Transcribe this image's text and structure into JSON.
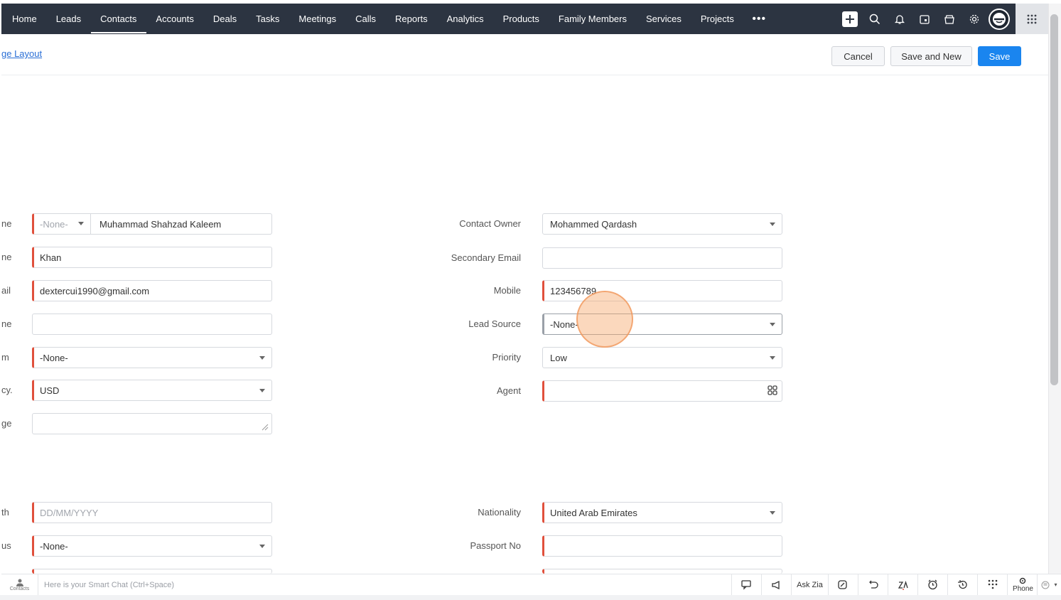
{
  "nav": {
    "items": [
      "Home",
      "Leads",
      "Contacts",
      "Accounts",
      "Deals",
      "Tasks",
      "Meetings",
      "Calls",
      "Reports",
      "Analytics",
      "Products",
      "Family Members",
      "Services",
      "Projects"
    ],
    "active": "Contacts",
    "more": "•••"
  },
  "header": {
    "layout_link": "ge Layout",
    "cancel": "Cancel",
    "save_and_new": "Save and New",
    "save": "Save",
    "primary_color": "#1a85ef"
  },
  "left_form": {
    "labels": [
      "ne",
      "ne",
      "ail",
      "ne",
      "m",
      "cy.",
      "ge",
      "th",
      "us"
    ],
    "salutation": "-None-",
    "first_name": "Muhammad Shahzad Kaleem",
    "last_name": "Khan",
    "email": "dextercui1990@gmail.com",
    "phone": "",
    "platform": "-None-",
    "currency": "USD",
    "message": "",
    "date_placeholder": "DD/MM/YYYY",
    "status": "-None-"
  },
  "right_form": {
    "contact_owner_label": "Contact Owner",
    "contact_owner": "Mohammed Qardash",
    "secondary_email_label": "Secondary Email",
    "secondary_email": "",
    "mobile_label": "Mobile",
    "mobile": "123456789",
    "lead_source_label": "Lead Source",
    "lead_source": "-None-",
    "priority_label": "Priority",
    "priority": "Low",
    "agent_label": "Agent",
    "agent": "",
    "nationality_label": "Nationality",
    "nationality": "United Arab Emirates",
    "passport_label": "Passport No",
    "passport": ""
  },
  "bottom": {
    "contacts": "Contacts",
    "smartchat_placeholder": "Here is your Smart Chat (Ctrl+Space)",
    "ask_zia": "Ask Zia",
    "phone": "Phone"
  }
}
